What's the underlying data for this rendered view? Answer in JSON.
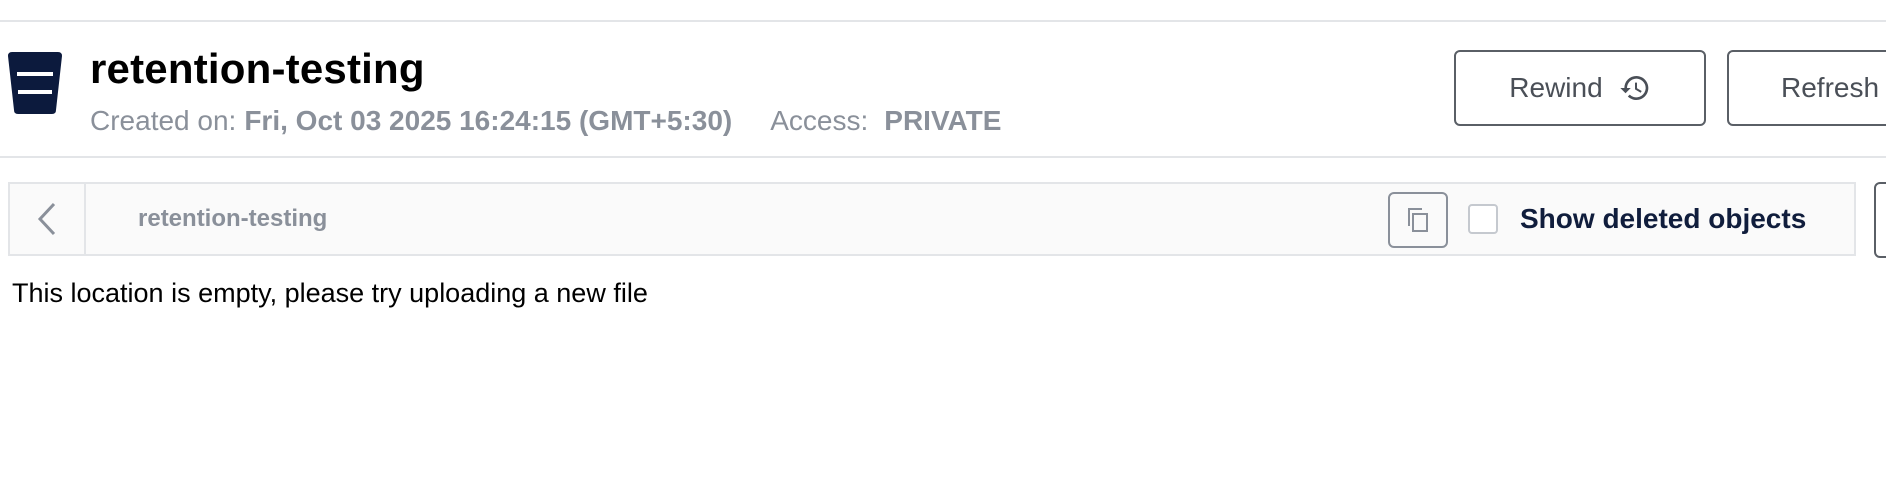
{
  "header": {
    "bucket_name": "retention-testing",
    "created_label": "Created on:",
    "created_value": "Fri, Oct 03 2025 16:24:15 (GMT+5:30)",
    "access_label": "Access:",
    "access_value": "PRIVATE",
    "rewind_label": "Rewind",
    "refresh_label": "Refresh"
  },
  "browser": {
    "path": "retention-testing",
    "show_deleted_label": "Show deleted objects",
    "show_deleted_checked": false,
    "empty_message": "This location is empty, please try uploading a new file"
  },
  "icons": {
    "bucket": "bucket-icon",
    "rewind": "history-icon",
    "back": "chevron-left-icon",
    "copy": "copy-icon"
  },
  "colors": {
    "bucket_icon": "#0c1a3d",
    "muted_text": "#8a909a",
    "label_strong": "#101d3c",
    "border": "#e3e5e8"
  }
}
